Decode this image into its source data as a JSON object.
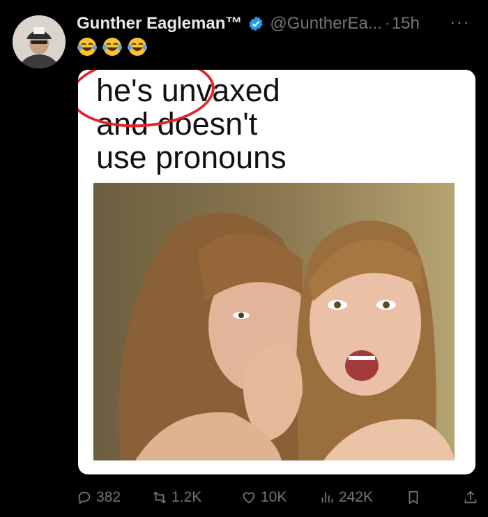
{
  "tweet": {
    "author_name": "Gunther Eagleman™",
    "handle": "@GuntherEa...",
    "separator": "·",
    "time": "15h",
    "more": "···",
    "emojis": [
      "😂",
      "😂",
      "😂"
    ],
    "meme_lines": [
      "he's unvaxed",
      "and doesn't",
      "use pronouns"
    ],
    "verified_color": "#1d9bf0",
    "circle_color": "#e0262a"
  },
  "actions": {
    "replies": "382",
    "reposts": "1.2K",
    "likes": "10K",
    "views": "242K"
  }
}
